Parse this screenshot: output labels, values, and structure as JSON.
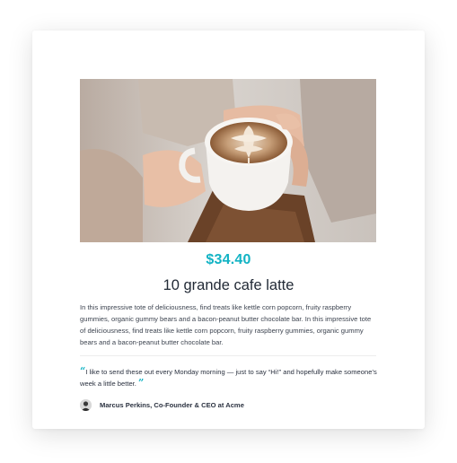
{
  "product": {
    "price": "$34.40",
    "title": "10 grande cafe latte",
    "description": "In this impressive tote of deliciousness, find treats like kettle corn popcorn, fruity raspberry gummies, organic gummy bears and a bacon-peanut butter chocolate bar. In this impressive tote of deliciousness, find treats like kettle corn popcorn, fruity raspberry gummies, organic gummy bears and a bacon-peanut butter chocolate bar."
  },
  "testimonial": {
    "open_quote": "“",
    "text": "I like to send these out every Monday morning — just to say “Hi!” and hopefully make someone’s week a little better.",
    "close_quote": "”",
    "author": "Marcus Perkins, Co-Founder & CEO at Acme"
  },
  "colors": {
    "accent": "#12b3c4"
  }
}
